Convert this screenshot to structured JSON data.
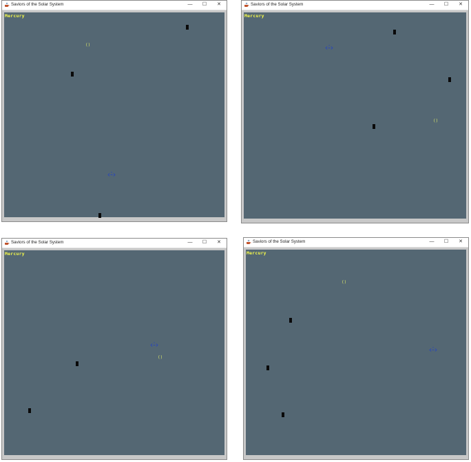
{
  "window": {
    "title": "Saviors of the Solar System",
    "minimize_glyph": "—",
    "maximize_glyph": "☐",
    "close_glyph": "✕",
    "app_icon": "java-cup-icon"
  },
  "hud": {
    "planet_label": "Mercury"
  },
  "colors": {
    "playfield": "#546773",
    "hud_text": "#f4f84a",
    "alien": "#0a0a0a",
    "coin": "#d7e46a",
    "ship": "#2b48b5"
  },
  "sprites": {
    "coin_glyph": "()",
    "ship_icon": "spaceship-icon",
    "alien_icon": "alien-block-icon"
  },
  "panels": [
    {
      "id": "top-left"
    },
    {
      "id": "top-right"
    },
    {
      "id": "bottom-left"
    },
    {
      "id": "bottom-right"
    }
  ]
}
